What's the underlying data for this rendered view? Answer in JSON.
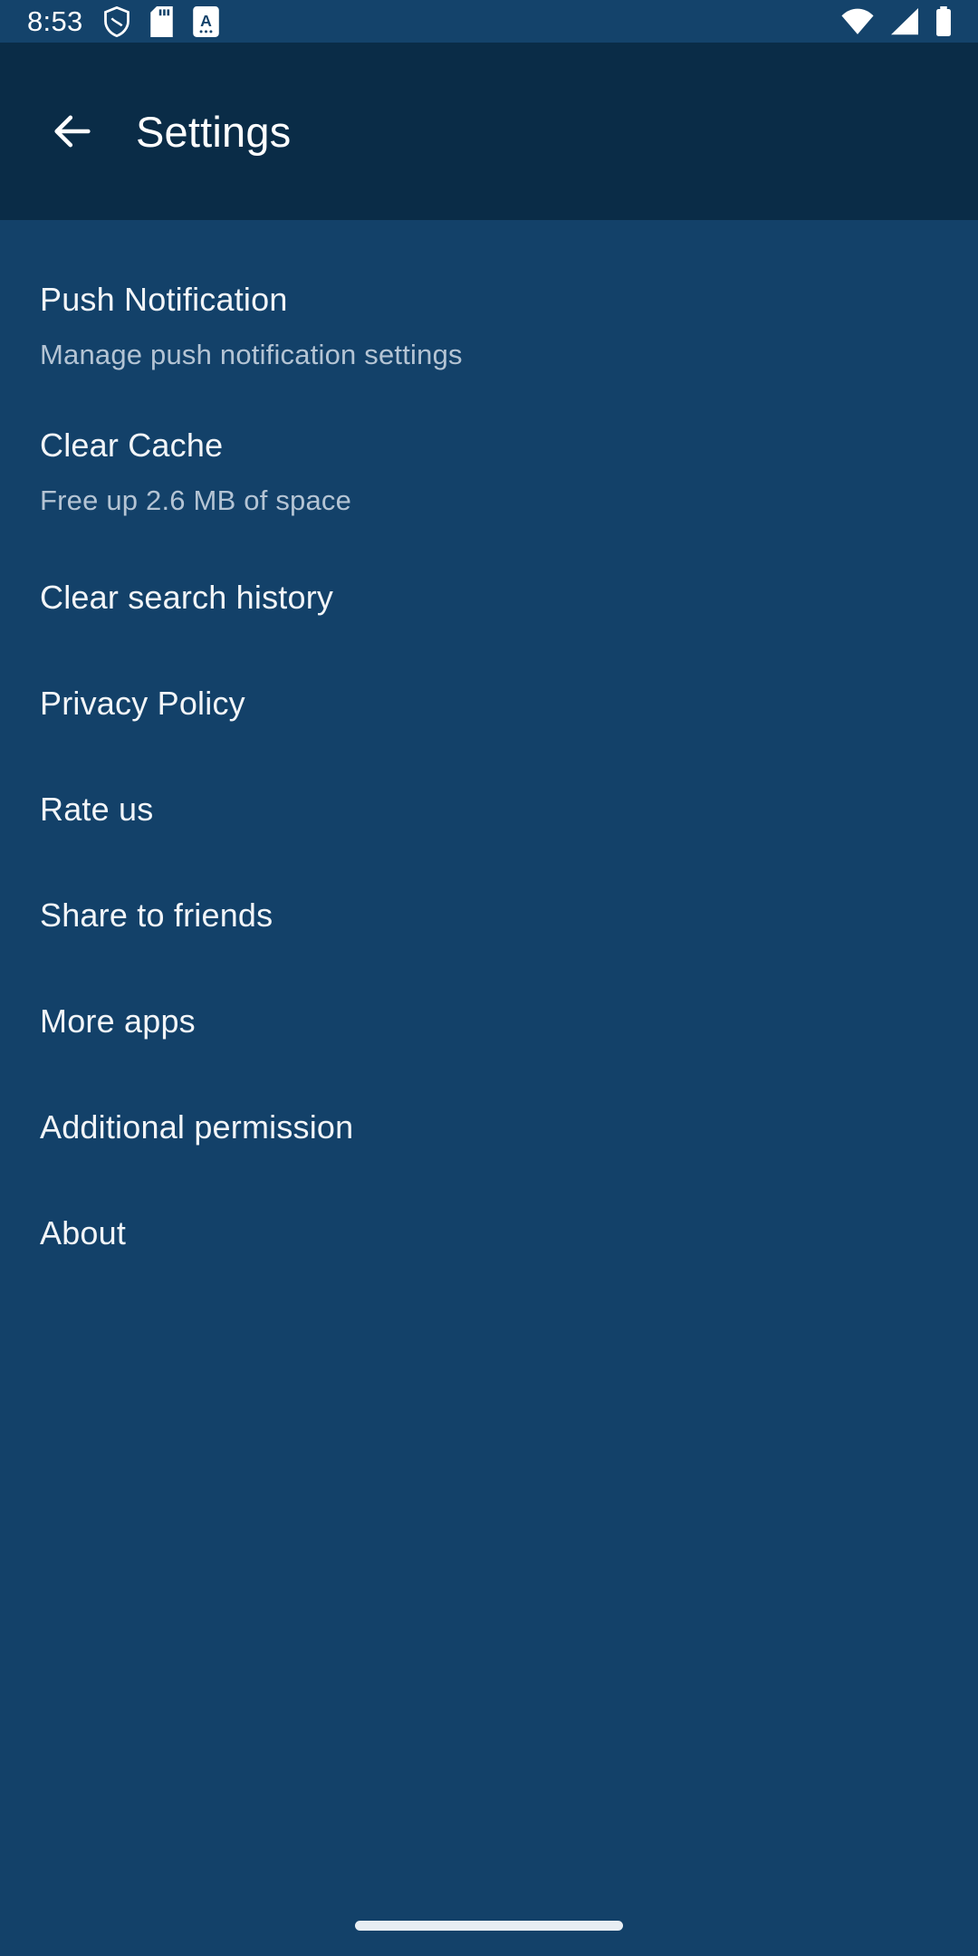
{
  "statusbar": {
    "time": "8:53",
    "left_icons": [
      {
        "name": "vpn-shield-icon",
        "label": "VPN active"
      },
      {
        "name": "sd-card-icon",
        "label": "SD card"
      },
      {
        "name": "screenshot-a-icon",
        "label": "A badge"
      }
    ],
    "right_icons": [
      {
        "name": "wifi-icon",
        "label": "Wi-Fi full signal"
      },
      {
        "name": "cellular-signal-icon",
        "label": "Mobile signal"
      },
      {
        "name": "battery-icon",
        "label": "Battery full"
      }
    ],
    "background_color": "#14436b"
  },
  "appbar": {
    "back_icon": "arrow-left-icon",
    "title": "Settings",
    "background_color": "#0a2c47",
    "text_color": "#ffffff"
  },
  "body": {
    "background_color": "#134169",
    "title_color": "#f2f5f8",
    "subtitle_color": "#b4c4d4"
  },
  "settings_items": [
    {
      "id": "push-notification",
      "title": "Push Notification",
      "subtitle": "Manage push notification settings"
    },
    {
      "id": "clear-cache",
      "title": "Clear Cache",
      "subtitle": "Free up 2.6 MB of space"
    },
    {
      "id": "clear-search-history",
      "title": "Clear search history"
    },
    {
      "id": "privacy-policy",
      "title": "Privacy Policy"
    },
    {
      "id": "rate-us",
      "title": "Rate us"
    },
    {
      "id": "share-to-friends",
      "title": "Share to friends"
    },
    {
      "id": "more-apps",
      "title": "More apps"
    },
    {
      "id": "additional-permission",
      "title": "Additional permission"
    },
    {
      "id": "about",
      "title": "About"
    }
  ],
  "gesture_bar": {
    "name": "home-gesture-pill",
    "color": "#e8eef3"
  }
}
